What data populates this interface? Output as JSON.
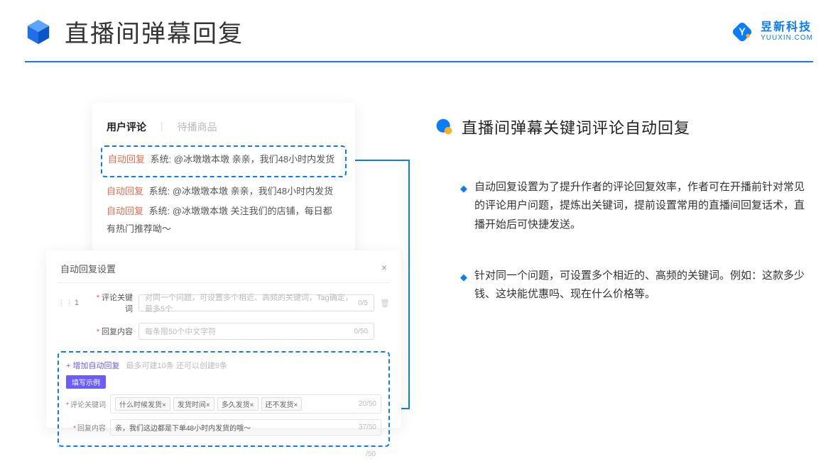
{
  "header": {
    "title": "直播间弹幕回复",
    "logo_cn": "昱新科技",
    "logo_en": "YUUXIN.COM"
  },
  "card1": {
    "tab_active": "用户评论",
    "tab_inactive": "待播商品",
    "autoreply_tag": "自动回复",
    "c1": "系统: @冰墩墩本墩 亲亲，我们48小时内发货",
    "c2": "系统: @冰墩墩本墩 亲亲，我们48小时内发货",
    "c3": "系统: @冰墩墩本墩 关注我们的店铺，每日都有热门推荐呦～"
  },
  "card2": {
    "title": "自动回复设置",
    "index": "1",
    "label_keyword": "评论关键词",
    "placeholder_keyword": "对同一个问题，可设置多个相近、高频的关键词，Tag确定，最多5个",
    "counter_keyword": "0/5",
    "label_content": "回复内容",
    "placeholder_content": "每条限50个中文字符",
    "counter_content": "0/50",
    "add_link": "+ 增加自动回复",
    "add_hint": "最多可建10条 还可以创建9条",
    "example_badge": "填写示例",
    "ex_label_keyword": "评论关键词",
    "tag1": "什么时候发货×",
    "tag2": "发货时间×",
    "tag3": "多久发货×",
    "tag4": "还不发货×",
    "ex_counter_keyword": "20/50",
    "ex_label_content": "回复内容",
    "ex_content": "亲，我们这边都是下单48小时内发货的哦～",
    "ex_counter_content": "37/50",
    "outer_counter": "/50"
  },
  "right": {
    "title": "直播间弹幕关键词评论自动回复",
    "b1": "自动回复设置为了提升作者的评论回复效率，作者可在开播前针对常见的评论用户问题，提炼出关键词，提前设置常用的直播间回复话术，直播开始后可快捷发送。",
    "b2": "针对同一个问题，可设置多个相近的、高频的关键词。例如：这款多少钱、这块能优惠吗、现在什么价格等。"
  }
}
